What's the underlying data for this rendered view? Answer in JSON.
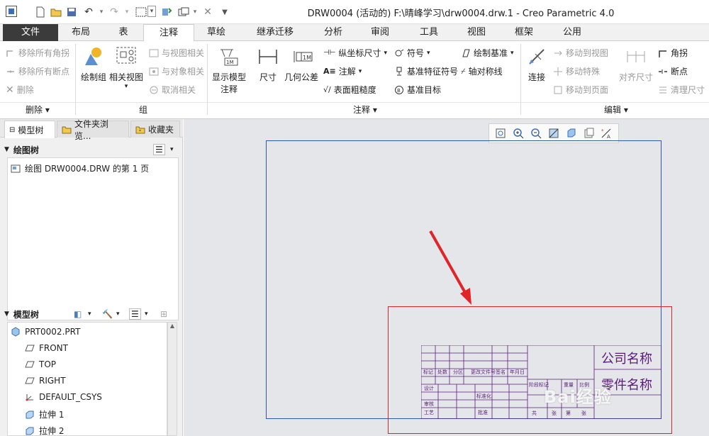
{
  "window": {
    "title": "DRW0004 (活动的) F:\\晴峰学习\\drw0004.drw.1 - Creo Parametric 4.0"
  },
  "tabs": [
    "文件",
    "布局",
    "表",
    "注释",
    "草绘",
    "继承迁移",
    "分析",
    "审阅",
    "工具",
    "视图",
    "框架",
    "公用"
  ],
  "active_tab": "注释",
  "ribbon": {
    "delete_group": {
      "label": "删除",
      "remove_all_corners": "移除所有角拐",
      "remove_all_breakpoints": "移除所有断点",
      "delete": "删除"
    },
    "group_group": {
      "label": "组",
      "draw_group": "绘制组",
      "related_view": "相关视图",
      "relate_to_view": "与视图相关",
      "relate_to_object": "与对象相关",
      "unrelate": "取消相关"
    },
    "annotation_group": {
      "label": "注释",
      "show_model_annotation_1": "显示模型",
      "show_model_annotation_2": "注释",
      "dimension": "尺寸",
      "geometric_tolerance": "几何公差",
      "ordinate_dimension": "纵坐标尺寸",
      "note": "注解",
      "surface_finish": "表面粗糙度",
      "symbol": "符号",
      "datum_feature_symbol": "基准特征符号",
      "datum_target": "基准目标",
      "draw_datum": "绘制基准",
      "axis_symmetry_line": "轴对称线"
    },
    "edit_group": {
      "label": "编辑",
      "connect": "连接",
      "move_to_view": "移动到视图",
      "move_special": "移动特殊",
      "move_to_page": "移动到页面",
      "align_dimensions": "对齐尺寸",
      "corner": "角拐",
      "breakpoint": "断点",
      "clean_dimensions": "清理尺寸"
    }
  },
  "nav_tabs": [
    "模型树",
    "文件夹浏览...",
    "收藏夹"
  ],
  "drawing_tree": {
    "title": "绘图树",
    "items": [
      "绘图 DRW0004.DRW 的第 1 页"
    ]
  },
  "model_tree": {
    "title": "模型树",
    "items": [
      "PRT0002.PRT",
      "FRONT",
      "TOP",
      "RIGHT",
      "DEFAULT_CSYS",
      "拉伸 1",
      "拉伸 2"
    ]
  },
  "title_block": {
    "company_name": "公司名称",
    "part_name": "零件名称",
    "row_labels": [
      "标记",
      "处数",
      "分区",
      "更改文件号",
      "签名",
      "年月日"
    ],
    "side_labels": [
      "设计",
      "审核",
      "工艺"
    ],
    "mid_labels": [
      "标准化",
      "批准"
    ],
    "stage_labels": [
      "阶段标记",
      "重量",
      "比例"
    ],
    "sheet_labels": [
      "共",
      "张",
      "第",
      "张"
    ]
  },
  "watermark": "Bai经验",
  "colors": {
    "sheet_border": "#2e5aa7",
    "highlight_border": "#e0242a",
    "arrow": "#e0242a",
    "title_block_lines": "#5a1b7a",
    "file_tab_bg": "#3b3b3b"
  }
}
